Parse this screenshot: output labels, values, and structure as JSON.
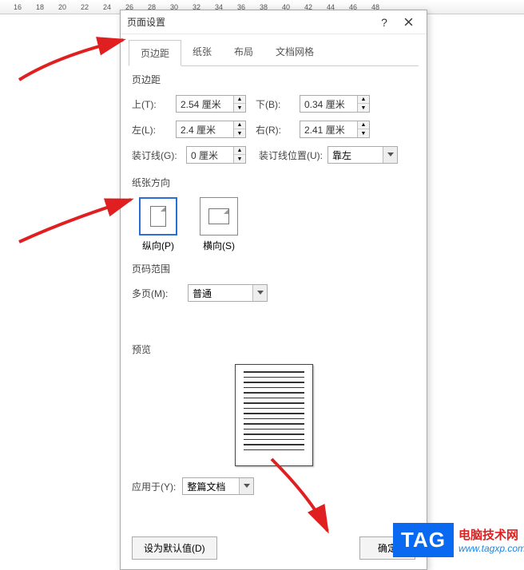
{
  "ruler": [
    "16",
    "18",
    "20",
    "22",
    "24",
    "26",
    "28",
    "30",
    "32",
    "34",
    "36",
    "38",
    "40",
    "42",
    "44",
    "46",
    "48"
  ],
  "dialog": {
    "title": "页面设置",
    "help": "?",
    "tabs": [
      "页边距",
      "纸张",
      "布局",
      "文档网格"
    ],
    "activeTabIndex": 0,
    "margins": {
      "section": "页边距",
      "topLabel": "上(T):",
      "topValue": "2.54 厘米",
      "bottomLabel": "下(B):",
      "bottomValue": "0.34 厘米",
      "leftLabel": "左(L):",
      "leftValue": "2.4 厘米",
      "rightLabel": "右(R):",
      "rightValue": "2.41 厘米",
      "gutterLabel": "装订线(G):",
      "gutterValue": "0 厘米",
      "gutterPosLabel": "装订线位置(U):",
      "gutterPosValue": "靠左"
    },
    "orientation": {
      "section": "纸张方向",
      "portrait": "纵向(P)",
      "landscape": "横向(S)",
      "selected": "portrait"
    },
    "pageRange": {
      "section": "页码范围",
      "multiLabel": "多页(M):",
      "multiValue": "普通"
    },
    "preview": {
      "section": "预览"
    },
    "applyTo": {
      "label": "应用于(Y):",
      "value": "整篇文档"
    },
    "footer": {
      "default": "设为默认值(D)",
      "ok": "确定"
    }
  },
  "watermark": {
    "tag": "TAG",
    "line1": "电脑技术网",
    "line2": "www.tagxp.com"
  }
}
